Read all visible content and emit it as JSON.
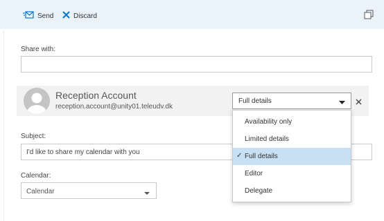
{
  "toolbar": {
    "send_label": "Send",
    "discard_label": "Discard",
    "send_icon": "envelope-send-icon",
    "discard_icon": "x-icon",
    "popout_icon": "popout-window-icon"
  },
  "share": {
    "label": "Share with:",
    "value": ""
  },
  "recipient": {
    "name": "Reception Account",
    "email": "reception.account@unity01.teleudv.dk",
    "permission": "Full details",
    "avatar_icon": "person-avatar-icon",
    "remove_icon": "close-icon"
  },
  "permission_options": [
    {
      "label": "Availability only"
    },
    {
      "label": "Limited details"
    },
    {
      "label": "Full details",
      "selected": true
    },
    {
      "label": "Editor"
    },
    {
      "label": "Delegate"
    }
  ],
  "subject": {
    "label": "Subject:",
    "value": "I'd like to share my calendar with you"
  },
  "calendar": {
    "label": "Calendar:",
    "value": "Calendar"
  },
  "colors": {
    "accent": "#0078d7",
    "toolbar_bg": "#eaf2fa",
    "selected_option_bg": "#c7e0f4"
  }
}
